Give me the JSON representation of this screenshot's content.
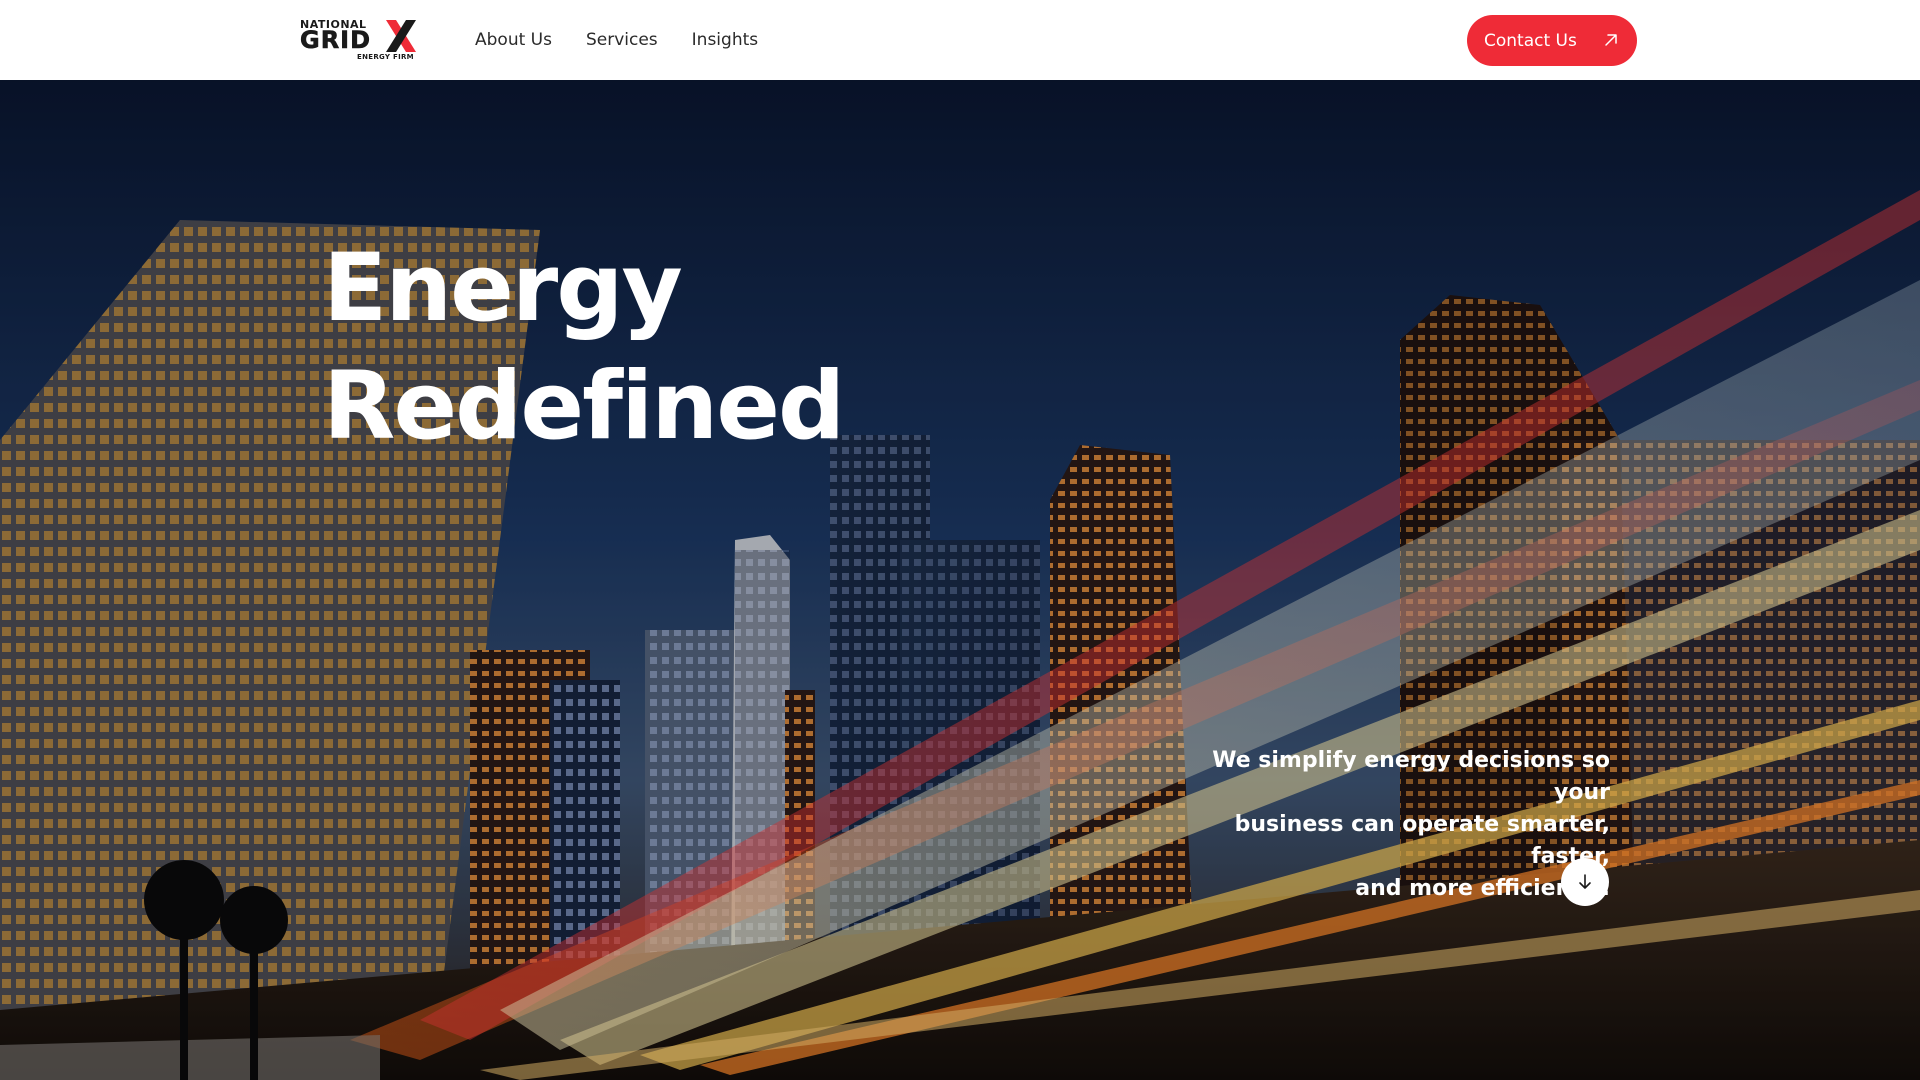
{
  "brand": {
    "logo_line1": "NATIONAL",
    "logo_line2": "GRID",
    "logo_line3": "ENERGY FIRM",
    "logo_mark_icon": "x-mark-icon",
    "accent_color": "#ef2b37"
  },
  "nav": {
    "items": [
      {
        "label": "About Us"
      },
      {
        "label": "Services"
      },
      {
        "label": "Insights"
      }
    ]
  },
  "header": {
    "contact_label": "Contact Us",
    "contact_icon": "arrow-up-right-icon"
  },
  "hero": {
    "headline_line1": "Energy",
    "headline_line2": "Redefined",
    "tagline_line1": "We simplify energy decisions so your",
    "tagline_line2": "business can operate smarter, faster,",
    "tagline_line3": "and more efficiently.",
    "scroll_icon": "arrow-down-icon",
    "background": "city-skyline-night-light-trails-photo"
  }
}
